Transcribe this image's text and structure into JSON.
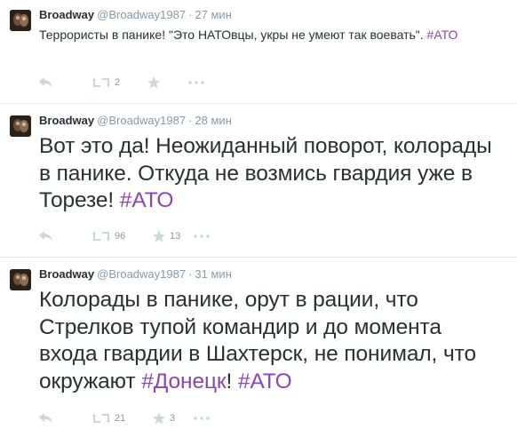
{
  "tweets": [
    {
      "fullname": "Broadway",
      "username": "@Broadway1987",
      "time": "27 мин",
      "text_parts": [
        "Террористы в панике! \"Это НАТОвцы, укры не умеют так воевать\". ",
        "#АТО"
      ],
      "retweets": "2",
      "favorites": ""
    },
    {
      "fullname": "Broadway",
      "username": "@Broadway1987",
      "time": "28 мин",
      "text_parts": [
        "Вот это да! Неожиданный поворот, колорады в панике. Откуда не возмись гвардия уже в Торезе! ",
        "#АТО"
      ],
      "retweets": "96",
      "favorites": "13"
    },
    {
      "fullname": "Broadway",
      "username": "@Broadway1987",
      "time": "31 мин",
      "text_parts": [
        "Колорады в панике, орут в рации, что Стрелков тупой командир и до момента входа гвардии в Шахтерск, не понимал, что окружают ",
        "#Донецк",
        "! ",
        "#АТО"
      ],
      "retweets": "21",
      "favorites": "3"
    }
  ],
  "separator": "·",
  "icons": [
    "reply-icon",
    "retweet-icon",
    "favorite-icon",
    "more-icon"
  ],
  "colors": {
    "hashtag": "#8e44ad",
    "meta": "#8899a6",
    "icon": "#ccd6dd"
  }
}
